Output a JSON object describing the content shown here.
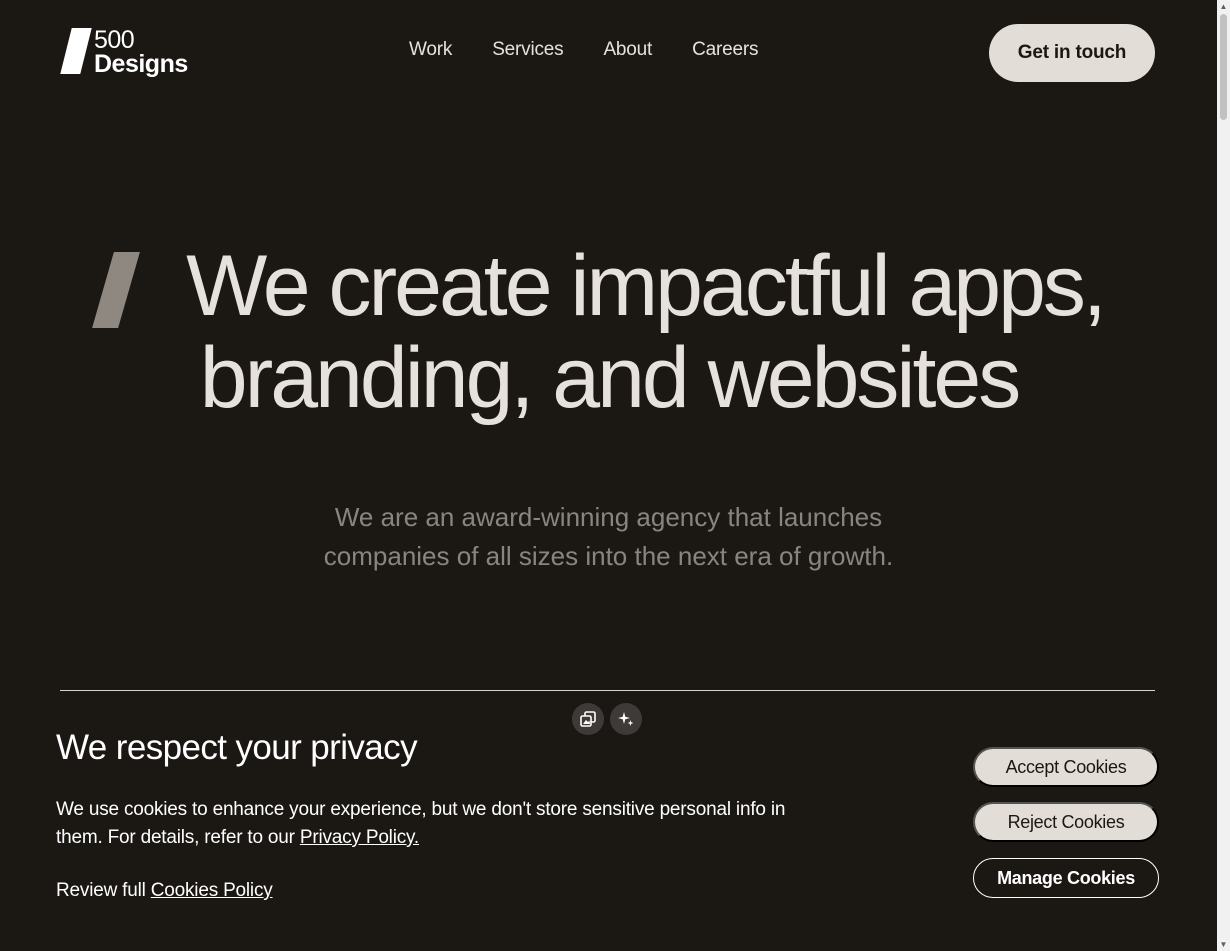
{
  "header": {
    "logo": {
      "number": "500",
      "word": "Designs"
    },
    "nav": [
      {
        "label": "Work"
      },
      {
        "label": "Services"
      },
      {
        "label": "About"
      },
      {
        "label": "Careers"
      }
    ],
    "cta_label": "Get in touch"
  },
  "hero": {
    "title_line1": "We create impactful apps,",
    "title_line2": "branding, and websites",
    "subtitle_line1": "We are an award-winning agency that launches",
    "subtitle_line2": "companies of all sizes into the next era of growth."
  },
  "tools": [
    {
      "icon": "copy-image-icon"
    },
    {
      "icon": "sparkle-icon"
    }
  ],
  "cookie": {
    "title": "We respect your privacy",
    "text_before_link": "We use cookies to enhance your experience, but we don't store sensitive personal info in them. For details, refer to our ",
    "privacy_link": "Privacy Policy.",
    "review_prefix": "Review full ",
    "cookies_link": "Cookies Policy",
    "accept_label": "Accept Cookies",
    "reject_label": "Reject Cookies",
    "manage_label": "Manage Cookies"
  },
  "colors": {
    "background": "#1b1814",
    "text": "#e6e1dc",
    "muted": "#8a847e",
    "button": "#e3ddd8"
  }
}
